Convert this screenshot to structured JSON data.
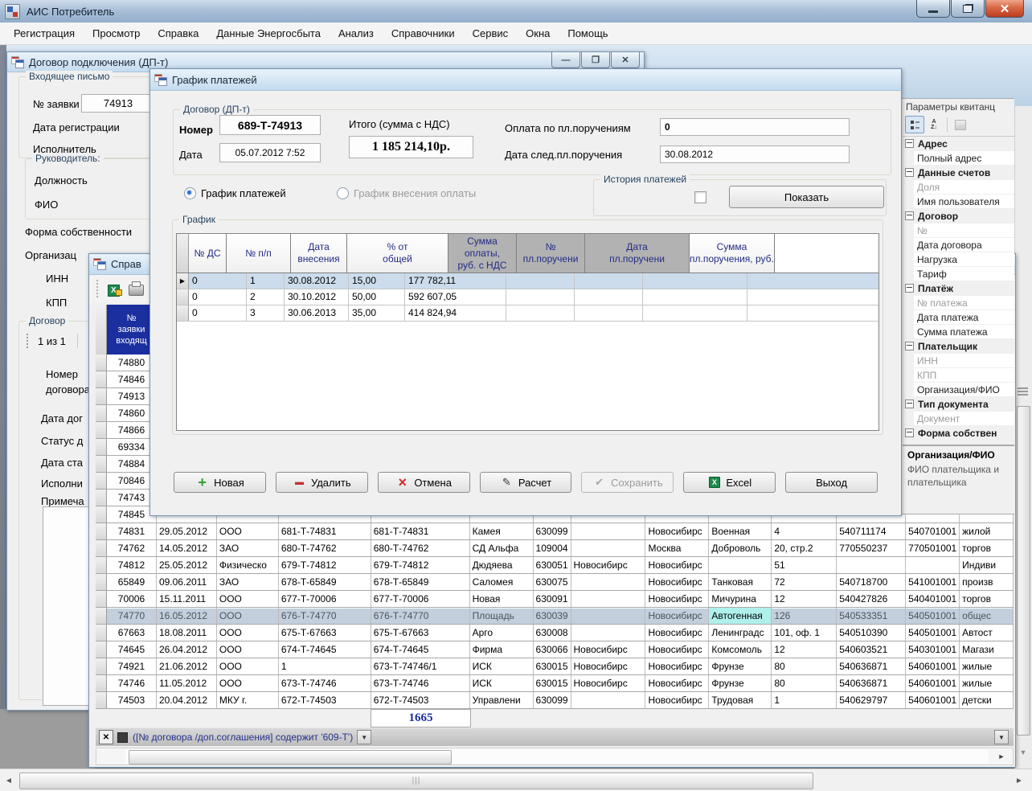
{
  "titlebar": {
    "title": "АИС Потребитель"
  },
  "menu": [
    "Регистрация",
    "Просмотр",
    "Справка",
    "Данные Энергосбыта",
    "Анализ",
    "Справочники",
    "Сервис",
    "Окна",
    "Помощь"
  ],
  "contract_window": {
    "title": "Договор подключения (ДП-т)",
    "incoming_group": "Входящее письмо",
    "request_no_label": "№ заявки",
    "request_no_value": "74913",
    "reg_date_label": "Дата регистрации",
    "executor_label": "Исполнитель",
    "head_group": "Руководитель:",
    "position_label": "Должность",
    "fio_label": "ФИО",
    "ownership_label": "Форма собственности",
    "organization_label": "Организац",
    "inn_label": "ИНН",
    "kpp_label": "КПП",
    "contract_group": "Договор",
    "pager": "1  из 1",
    "number_label": "Номер договора",
    "date_label": "Дата дог",
    "status_label": "Статус д",
    "status_date_label": "Дата ста",
    "executor2_label": "Исполни",
    "note_label": "Примеча"
  },
  "dialog": {
    "title": "График платежей",
    "contract_group": "Договор (ДП-т)",
    "number_label": "Номер",
    "number_value": "689-Т-74913",
    "date_label": "Дата",
    "date_value": "05.07.2012 7:52",
    "total_label": "Итого (сумма с НДС)",
    "total_value": "1 185 214,10р.",
    "paid_label": "Оплата по пл.поручениям",
    "paid_value": "0",
    "next_date_label": "Дата след.пл.поручения",
    "next_date_value": "30.08.2012",
    "radio_schedule": "График платежей",
    "radio_payment": "График внесения оплаты",
    "history_group": "История платежей",
    "show_button": "Показать",
    "grid_group": "График",
    "table": {
      "headers": [
        "№ ДС",
        "№ п/п",
        "Дата\nвнесения",
        "% от\nобщей",
        "Сумма оплаты,\nруб.    с НДС",
        "№\nпл.поручени",
        "Дата\nпл.поручени",
        "Сумма\nпл.поручения, руб."
      ],
      "rows": [
        {
          "cls": "selected",
          "cells": [
            "0",
            "1",
            "30.08.2012",
            "15,00",
            "177 782,11",
            "",
            "",
            ""
          ]
        },
        {
          "cls": "",
          "cells": [
            "0",
            "2",
            "30.10.2012",
            "50,00",
            "592 607,05",
            "",
            "",
            ""
          ]
        },
        {
          "cls": "",
          "cells": [
            "0",
            "3",
            "30.06.2013",
            "35,00",
            "414 824,94",
            "",
            "",
            ""
          ]
        }
      ]
    },
    "buttons": [
      {
        "label": "Новая",
        "icon": "ico-plus",
        "cls": ""
      },
      {
        "label": "Удалить",
        "icon": "ico-minus",
        "cls": ""
      },
      {
        "label": "Отмена",
        "icon": "ico-x",
        "cls": ""
      },
      {
        "label": "Расчет",
        "icon": "ico-calc",
        "cls": ""
      },
      {
        "label": "Сохранить",
        "icon": "ico-check",
        "cls": "disabled"
      },
      {
        "label": "Excel",
        "icon": "ico-excel",
        "cls": ""
      },
      {
        "label": "Выход",
        "icon": "ico-none",
        "cls": ""
      }
    ]
  },
  "sprav": {
    "title": "Справ",
    "side_header": "№\nзаявки\nвходящ",
    "grid_rows": [
      {
        "cls": "",
        "cells": [
          "74880",
          "",
          "",
          "",
          "",
          "",
          "",
          "",
          "",
          "",
          "",
          "",
          "",
          ""
        ]
      },
      {
        "cls": "",
        "cells": [
          "74846",
          "",
          "",
          "",
          "",
          "",
          "",
          "",
          "",
          "",
          "",
          "",
          "",
          ""
        ]
      },
      {
        "cls": "",
        "cells": [
          "74913",
          "",
          "",
          "",
          "",
          "",
          "",
          "",
          "",
          "",
          "",
          "",
          "",
          ""
        ]
      },
      {
        "cls": "",
        "cells": [
          "74860",
          "",
          "",
          "",
          "",
          "",
          "",
          "",
          "",
          "",
          "",
          "",
          "",
          ""
        ]
      },
      {
        "cls": "",
        "cells": [
          "74866",
          "",
          "",
          "",
          "",
          "",
          "",
          "",
          "",
          "",
          "",
          "",
          "",
          ""
        ]
      },
      {
        "cls": "",
        "cells": [
          "69334",
          "",
          "",
          "",
          "",
          "",
          "",
          "",
          "",
          "",
          "",
          "",
          "",
          ""
        ]
      },
      {
        "cls": "",
        "cells": [
          "74884",
          "",
          "",
          "",
          "",
          "",
          "",
          "",
          "",
          "",
          "",
          "",
          "",
          ""
        ]
      },
      {
        "cls": "",
        "cells": [
          "70846",
          "",
          "",
          "",
          "",
          "",
          "",
          "",
          "",
          "",
          "",
          "",
          "",
          ""
        ]
      },
      {
        "cls": "",
        "cells": [
          "74743",
          "",
          "",
          "",
          "",
          "",
          "",
          "",
          "",
          "",
          "",
          "",
          "",
          ""
        ]
      },
      {
        "cls": "",
        "cells": [
          "74845",
          "",
          "",
          "",
          "",
          "",
          "",
          "",
          "",
          "",
          "",
          "",
          "",
          ""
        ]
      },
      {
        "cls": "",
        "cells": [
          "74831",
          "29.05.2012",
          "ООО",
          "681-Т-74831",
          "681-Т-74831",
          "Камея",
          "630099",
          "",
          "Новосибирс",
          "Военная",
          "4",
          "540711174",
          "540701001",
          "жилой"
        ]
      },
      {
        "cls": "",
        "cells": [
          "74762",
          "14.05.2012",
          "ЗАО",
          "680-Т-74762",
          "680-Т-74762",
          "СД Альфа",
          "109004",
          "",
          "Москва",
          "Доброволь",
          "20, стр.2",
          "770550237",
          "770501001",
          "торгов"
        ]
      },
      {
        "cls": "",
        "cells": [
          "74812",
          "25.05.2012",
          "Физическо",
          "679-Т-74812",
          "679-Т-74812",
          "Дюдяева",
          "630051",
          "Новосибирс",
          "Новосибирс",
          "",
          "51",
          "",
          "",
          "Индиви"
        ]
      },
      {
        "cls": "",
        "cells": [
          "65849",
          "09.06.2011",
          "ЗАО",
          "678-Т-65849",
          "678-Т-65849",
          "Саломея",
          "630075",
          "",
          "Новосибирс",
          "Танковая",
          "72",
          "540718700",
          "541001001",
          "произв"
        ]
      },
      {
        "cls": "",
        "cells": [
          "70006",
          "15.11.2011",
          "ООО",
          "677-Т-70006",
          "677-Т-70006",
          "Новая",
          "630091",
          "",
          "Новосибирс",
          "Мичурина",
          "12",
          "540427826",
          "540401001",
          "торгов"
        ]
      },
      {
        "cls": "selected",
        "cells": [
          "74770",
          "16.05.2012",
          "ООО",
          "676-Т-74770",
          "676-Т-74770",
          "Площадь",
          "630039",
          "",
          "Новосибирс",
          "Автогенная",
          "126",
          "540533351",
          "540501001",
          "общес"
        ]
      },
      {
        "cls": "",
        "cells": [
          "67663",
          "18.08.2011",
          "ООО",
          "675-Т-67663",
          "675-Т-67663",
          "Арго",
          "630008",
          "",
          "Новосибирс",
          "Ленинградс",
          "101, оф. 1",
          "540510390",
          "540501001",
          "Автост"
        ]
      },
      {
        "cls": "",
        "cells": [
          "74645",
          "26.04.2012",
          "ООО",
          "674-Т-74645",
          "674-Т-74645",
          "Фирма",
          "630066",
          "Новосибирс",
          "Новосибирс",
          "Комсомоль",
          "12",
          "540603521",
          "540301001",
          "Магази"
        ]
      },
      {
        "cls": "",
        "cells": [
          "74921",
          "21.06.2012",
          "ООО",
          "1",
          "673-Т-74746/1",
          "ИСК",
          "630015",
          "Новосибирс",
          "Новосибирс",
          "Фрунзе",
          "80",
          "540636871",
          "540601001",
          "жилые"
        ]
      },
      {
        "cls": "",
        "cells": [
          "74746",
          "11.05.2012",
          "ООО",
          "673-Т-74746",
          "673-Т-74746",
          "ИСК",
          "630015",
          "Новосибирс",
          "Новосибирс",
          "Фрунзе",
          "80",
          "540636871",
          "540601001",
          "жилые"
        ]
      },
      {
        "cls": "",
        "cells": [
          "74503",
          "20.04.2012",
          "МКУ г.",
          "672-Т-74503",
          "672-Т-74503",
          "Управлени",
          "630099",
          "",
          "Новосибирс",
          "Трудовая",
          "1",
          "540629797",
          "540601001",
          "детски"
        ]
      }
    ],
    "total": "1665",
    "filter_text": "([№ договора /доп.соглашения] содержит '609-Т')"
  },
  "params": {
    "caption": "Параметры квитанц",
    "items": [
      {
        "label": "Адрес",
        "cls": "cat"
      },
      {
        "label": "Полный адрес",
        "cls": "item"
      },
      {
        "label": "Данные счетов",
        "cls": "cat"
      },
      {
        "label": "Доля",
        "cls": "item dim"
      },
      {
        "label": "Имя пользователя",
        "cls": "item"
      },
      {
        "label": "Договор",
        "cls": "cat"
      },
      {
        "label": "№",
        "cls": "item dim"
      },
      {
        "label": "Дата договора",
        "cls": "item"
      },
      {
        "label": "Нагрузка",
        "cls": "item"
      },
      {
        "label": "Тариф",
        "cls": "item"
      },
      {
        "label": "Платёж",
        "cls": "cat"
      },
      {
        "label": "№ платежа",
        "cls": "item dim"
      },
      {
        "label": "Дата платежа",
        "cls": "item"
      },
      {
        "label": "Сумма платежа",
        "cls": "item"
      },
      {
        "label": "Плательщик",
        "cls": "cat"
      },
      {
        "label": "ИНН",
        "cls": "item dim"
      },
      {
        "label": "КПП",
        "cls": "item dim"
      },
      {
        "label": "Организация/ФИО",
        "cls": "item"
      },
      {
        "label": "Тип документа",
        "cls": "cat"
      },
      {
        "label": "Документ",
        "cls": "item dim"
      },
      {
        "label": "Форма собствен",
        "cls": "cat"
      }
    ],
    "desc_title": "Организация/ФИО",
    "desc_text": "ФИО плательщика и\nплательщика"
  }
}
